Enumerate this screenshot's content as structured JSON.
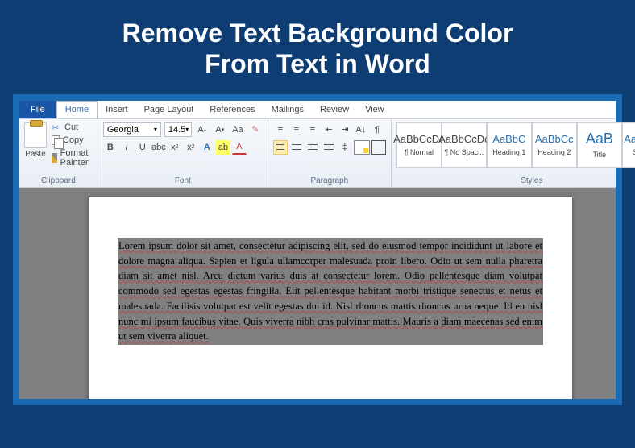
{
  "tutorial": {
    "title_line1": "Remove Text Background Color",
    "title_line2": "From Text in Word"
  },
  "tabs": {
    "file": "File",
    "items": [
      "Home",
      "Insert",
      "Page Layout",
      "References",
      "Mailings",
      "Review",
      "View"
    ],
    "active": "Home"
  },
  "ribbon": {
    "clipboard": {
      "label": "Clipboard",
      "paste": "Paste",
      "cut": "Cut",
      "copy": "Copy",
      "format_painter": "Format Painter"
    },
    "font": {
      "label": "Font",
      "name": "Georgia",
      "size": "14.5"
    },
    "paragraph": {
      "label": "Paragraph"
    },
    "styles": {
      "label": "Styles",
      "items": [
        {
          "preview": "AaBbCcDc",
          "name": "¶ Normal",
          "blue": false,
          "lg": false
        },
        {
          "preview": "AaBbCcDc",
          "name": "¶ No Spaci..",
          "blue": false,
          "lg": false
        },
        {
          "preview": "AaBbC",
          "name": "Heading 1",
          "blue": true,
          "lg": false
        },
        {
          "preview": "AaBbCc",
          "name": "Heading 2",
          "blue": true,
          "lg": false
        },
        {
          "preview": "AaB",
          "name": "Title",
          "blue": true,
          "lg": true
        },
        {
          "preview": "AaBbCc.",
          "name": "Subtitle",
          "blue": true,
          "lg": false
        }
      ]
    }
  },
  "document": {
    "paragraph": "Lorem ipsum dolor sit amet, consectetur adipiscing elit, sed do eiusmod tempor incididunt ut labore et dolore magna aliqua. Sapien et ligula ullamcorper malesuada proin libero. Odio ut sem nulla pharetra diam sit amet nisl. Arcu dictum varius duis at consectetur lorem. Odio pellentesque diam volutpat commodo sed egestas egestas fringilla. Elit pellentesque habitant morbi tristique senectus et netus et malesuada. Facilisis volutpat est velit egestas dui id. Nisl rhoncus mattis rhoncus urna neque. Id eu nisl nunc mi ipsum faucibus vitae. Quis viverra nibh cras pulvinar mattis. Mauris a diam maecenas sed enim ut sem viverra aliquet."
  }
}
